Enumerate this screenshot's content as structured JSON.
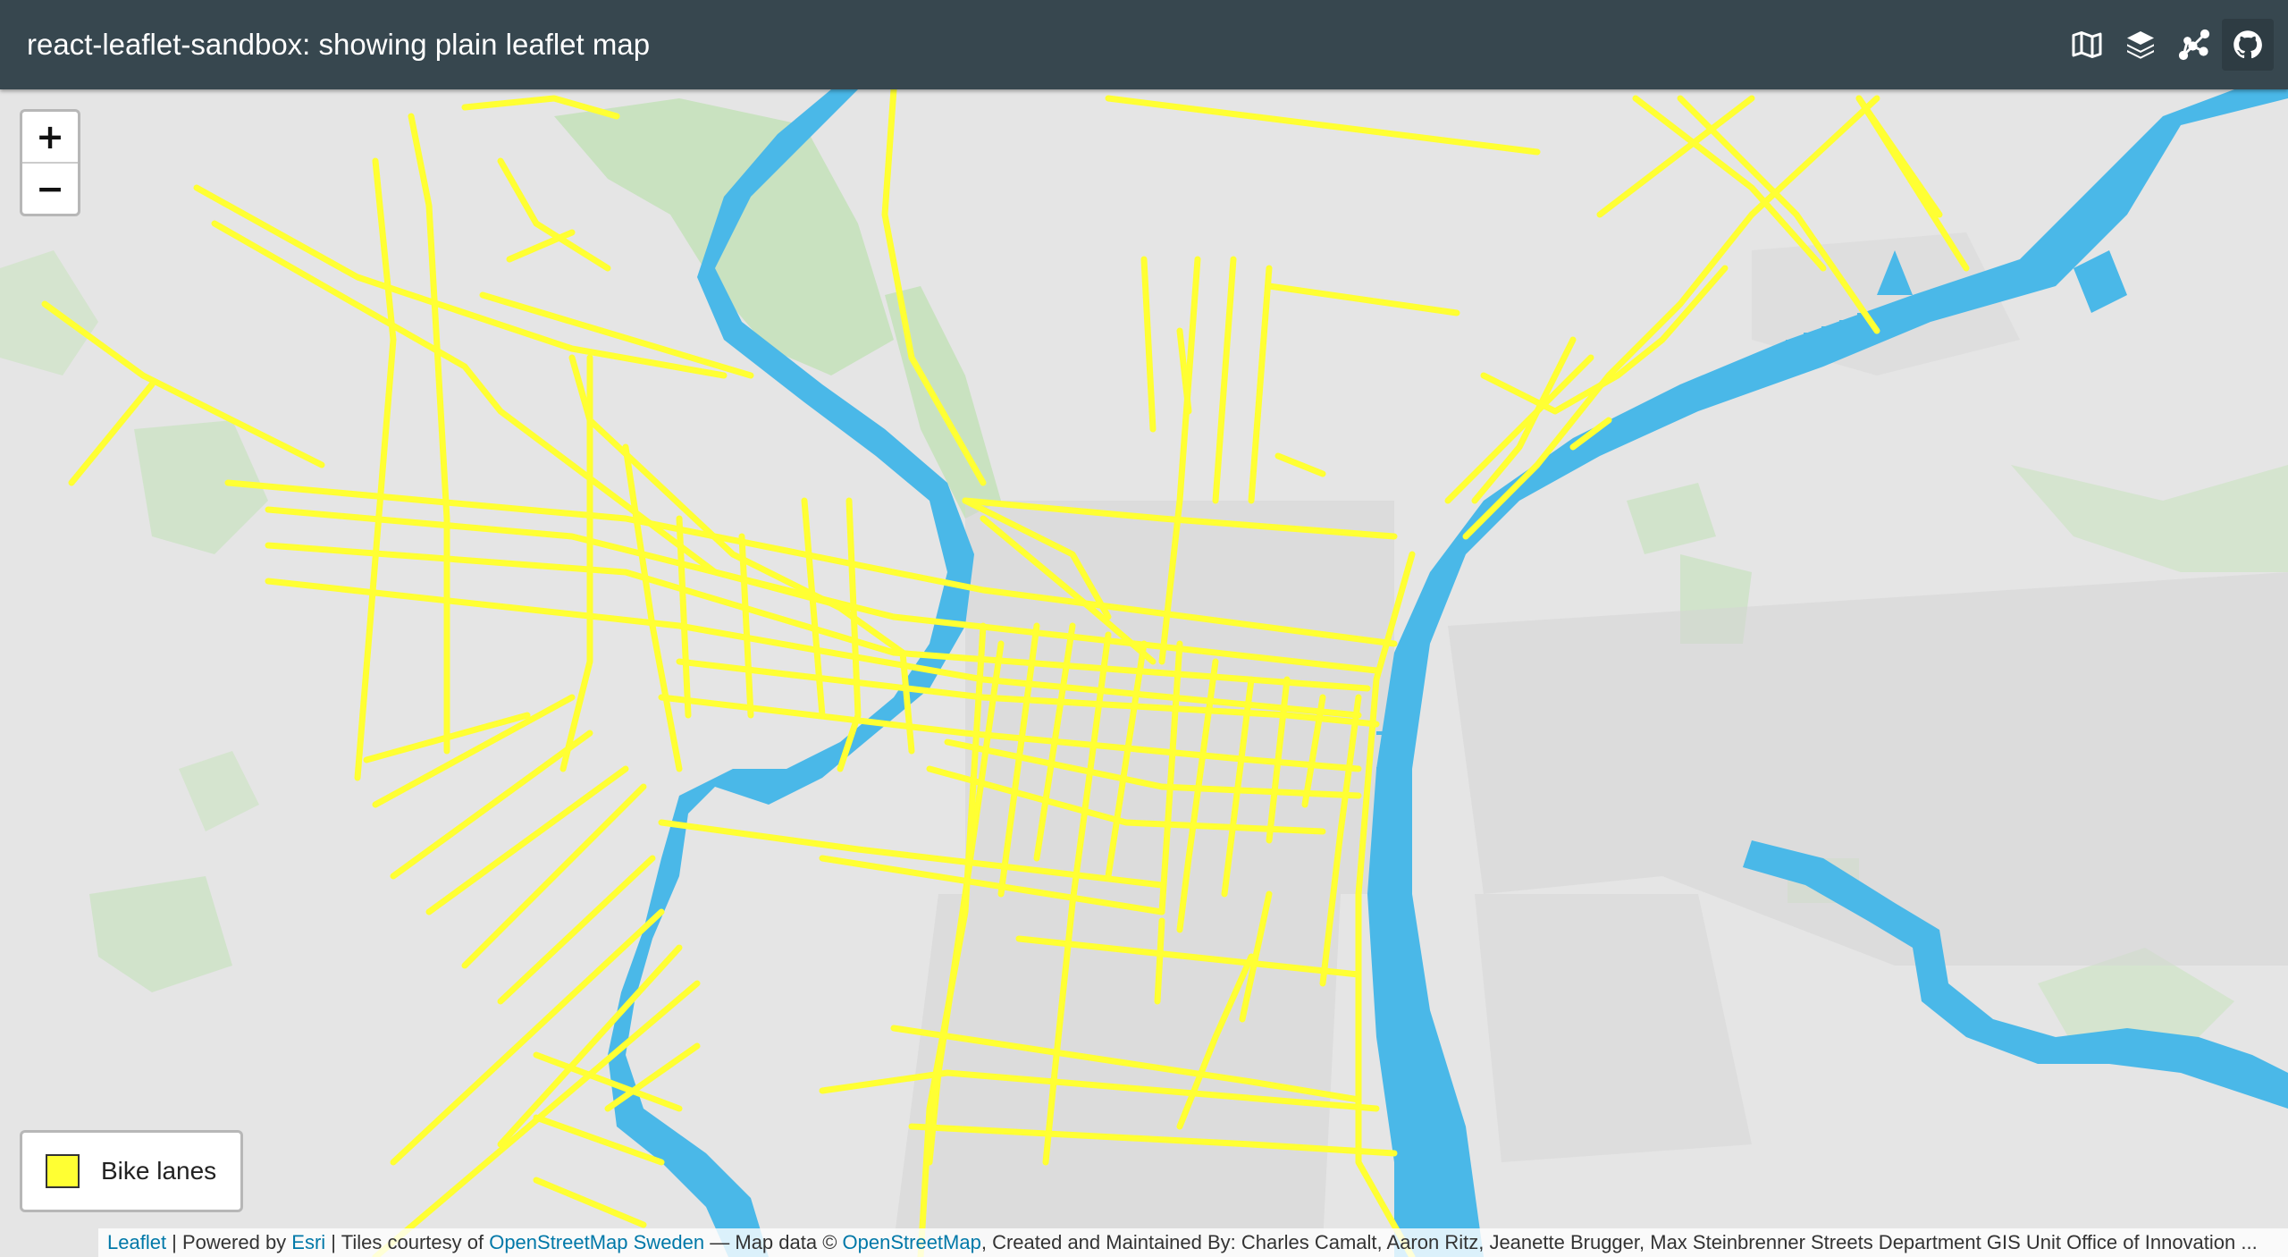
{
  "header": {
    "title": "react-leaflet-sandbox: showing plain leaflet map"
  },
  "toolbar": {
    "icons": [
      "map-icon",
      "layers-icon",
      "network-icon",
      "github-icon"
    ],
    "active_index": 3
  },
  "zoom": {
    "in_label": "+",
    "out_label": "−"
  },
  "legend": {
    "label": "Bike lanes",
    "color": "#ffff33"
  },
  "attribution": {
    "leaflet": "Leaflet",
    "sep1": " | Powered by ",
    "esri": "Esri",
    "sep2": " | Tiles courtesy of ",
    "osm_sweden": "OpenStreetMap Sweden",
    "sep3": " — Map data © ",
    "osm": "OpenStreetMap",
    "rest": ", Created and Maintained By: Charles Camalt, Aaron Ritz, Jeanette Brugger, Max Steinbrenner Streets Department GIS Unit Office of Innovation ..."
  },
  "map": {
    "land_color": "#e5e5e5",
    "water_color": "#4ab8e8",
    "park_color": "#c9e2c0",
    "urban_color": "#d4d4d4",
    "bike_lane_color": "#ffff33"
  }
}
